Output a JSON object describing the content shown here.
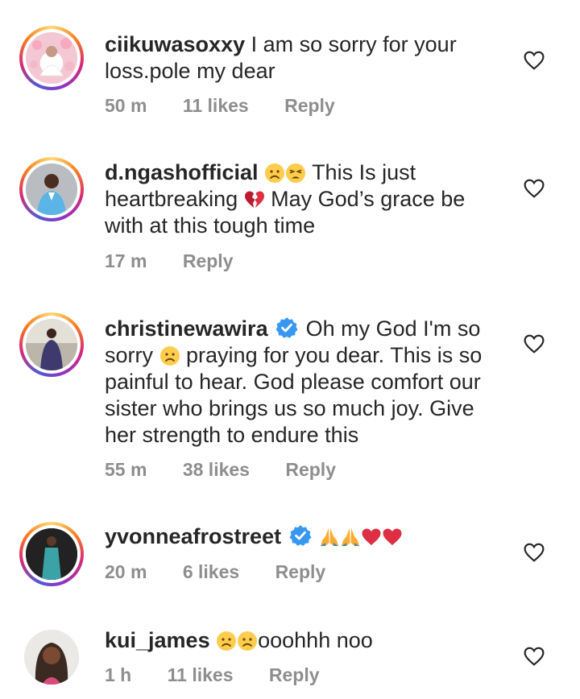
{
  "comments": [
    {
      "username": "ciikuwasoxxy",
      "text": "I am so sorry for your loss.pole my dear",
      "time": "50 m",
      "likes": "11 likes",
      "reply": "Reply"
    },
    {
      "username": "d.ngashofficial",
      "text_a": "This Is just heartbreaking",
      "text_b": "May God’s grace be with at this tough time",
      "time": "17 m",
      "reply": "Reply"
    },
    {
      "username": "christinewawira",
      "text_a": "Oh my God I'm so sorry",
      "text_b": "praying for you dear. This is so painful to hear. God please comfort our sister who brings us so much joy. Give her strength to endure this",
      "time": "55 m",
      "likes": "38 likes",
      "reply": "Reply"
    },
    {
      "username": "yvonneafrostreet",
      "time": "20 m",
      "likes": "6 likes",
      "reply": "Reply"
    },
    {
      "username": "kui_james",
      "text": "ooohhh noo",
      "time": "1 h",
      "likes": "11 likes",
      "reply": "Reply"
    }
  ],
  "icons": {
    "like": "heart-outline-icon",
    "verified": "verified-badge-icon",
    "sad": "sad-face-emoji",
    "weary": "weary-face-emoji",
    "broken_heart": "broken-heart-emoji",
    "pray": "folded-hands-emoji",
    "heart": "red-heart-emoji"
  },
  "colors": {
    "text": "#262626",
    "meta": "#8e8e8e",
    "verified": "#3897f0",
    "emoji_face": "#ffcc4d",
    "heart": "#dd2e44"
  }
}
